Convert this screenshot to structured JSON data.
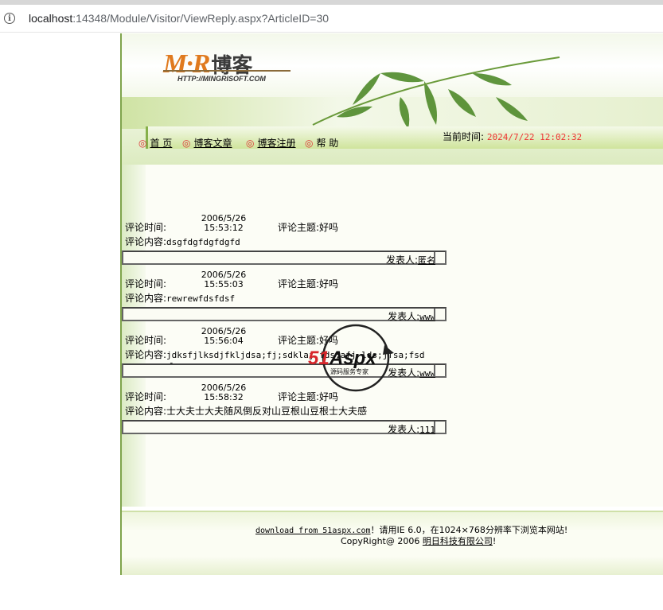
{
  "browser": {
    "url_host": "localhost",
    "url_rest": ":14348/Module/Visitor/ViewReply.aspx?ArticleID=30"
  },
  "banner": {
    "logo_mr": "M·R",
    "logo_blog": "博客",
    "logo_url": "HTTP://MINGRISOFT.COM"
  },
  "nav": {
    "items": [
      {
        "label": "首 页"
      },
      {
        "label": "博客文章"
      },
      {
        "label": "博客注册"
      },
      {
        "label": "帮 助"
      }
    ],
    "time_label": "当前时间:",
    "time_value": "2024/7/22 12:02:32"
  },
  "replies": [
    {
      "time_label": "评论时间:",
      "date": "2006/5/26",
      "time": "15:53:12",
      "subject_label": "评论主题:",
      "subject": "好吗",
      "content_label": "评论内容:",
      "content": "dsgfdgfdgfdgfd",
      "poster_label": "发表人:",
      "poster": "匿名"
    },
    {
      "time_label": "评论时间:",
      "date": "2006/5/26",
      "time": "15:55:03",
      "subject_label": "评论主题:",
      "subject": "好吗",
      "content_label": "评论内容:",
      "content": "rewrewfdsfdsf",
      "poster_label": "发表人:",
      "poster": "www"
    },
    {
      "time_label": "评论时间:",
      "date": "2006/5/26",
      "time": "15:56:04",
      "subject_label": "评论主题:",
      "subject": "好吗",
      "content_label": "评论内容:",
      "content": "jdksfjlksdjfkljdsa;fj;sdklaj fds;afj lds;jfsa;fsd",
      "content_line2": "f",
      "poster_label": "发表人:",
      "poster": "www"
    },
    {
      "time_label": "评论时间:",
      "date": "2006/5/26",
      "time": "15:58:32",
      "subject_label": "评论主题:",
      "subject": "好吗",
      "content_label": "评论内容:",
      "content": "士大夫士大夫随风倒反对山豆根山豆根士大夫感",
      "poster_label": "发表人:",
      "poster": "111"
    }
  ],
  "footer": {
    "download_link": "download from 51aspx.com",
    "notice": "！请用IE 6.0，在1024×768分辨率下浏览本网站!",
    "copyright": "CopyRight@ 2006 ",
    "company": "明日科技有限公司",
    "end": "!"
  },
  "watermark": {
    "brand": "51Aspx",
    "tagline": "源码服务专家"
  }
}
